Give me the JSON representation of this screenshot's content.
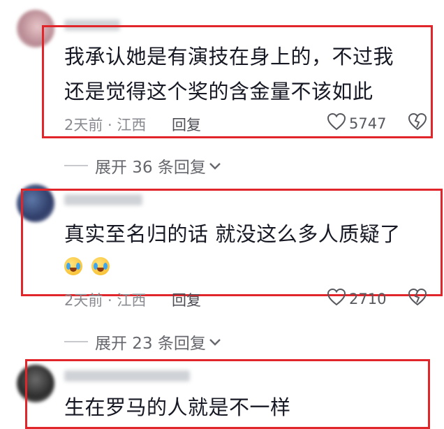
{
  "comments": [
    {
      "text_lines": [
        "我承认她是有演技在身上的，不过我",
        "还是觉得这个奖的含金量不该如此"
      ],
      "meta": "2天前 · 江西",
      "reply_label": "回复",
      "likes": "5747",
      "expand_label": "展开 36 条回复"
    },
    {
      "text_lines": [
        "真实至名归的话 就没这么多人质疑了"
      ],
      "emojis": [
        "crying-laughing",
        "crying-laughing"
      ],
      "meta": "2天前 · 江西",
      "reply_label": "回复",
      "likes": "2710",
      "expand_label": "展开 23 条回复"
    },
    {
      "text_lines": [
        "生在罗马的人就是不一样"
      ]
    }
  ],
  "colors": {
    "highlight_box": "#e0262a",
    "text": "#161823",
    "meta": "#8a8b91"
  },
  "icons": {
    "like": "heart-outline-icon",
    "dislike": "broken-heart-icon",
    "expand": "chevron-down-icon"
  }
}
